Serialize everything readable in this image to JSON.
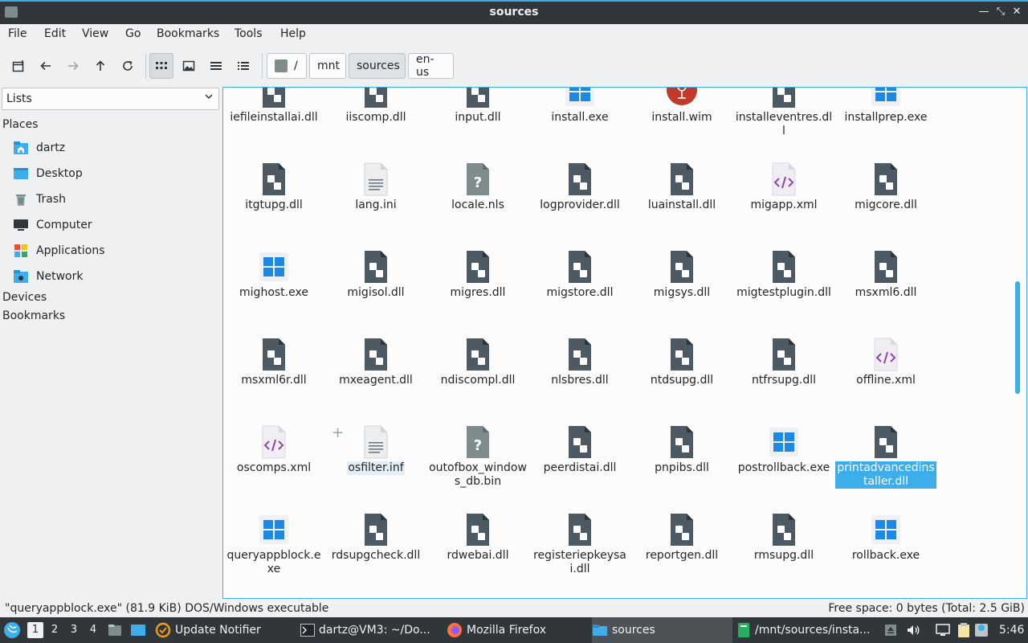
{
  "window": {
    "title": "sources"
  },
  "menu": [
    "File",
    "Edit",
    "View",
    "Go",
    "Bookmarks",
    "Tools",
    "Help"
  ],
  "breadcrumbs": [
    "/",
    "mnt",
    "sources",
    "en-us"
  ],
  "sidebar": {
    "mode": "Lists",
    "places_label": "Places",
    "places": [
      {
        "label": "dartz",
        "icon": "home-folder-icon"
      },
      {
        "label": "Desktop",
        "icon": "desktop-icon"
      },
      {
        "label": "Trash",
        "icon": "trash-icon"
      },
      {
        "label": "Computer",
        "icon": "computer-icon"
      },
      {
        "label": "Applications",
        "icon": "applications-icon"
      },
      {
        "label": "Network",
        "icon": "network-icon"
      }
    ],
    "devices_label": "Devices",
    "bookmarks_label": "Bookmarks"
  },
  "files": [
    {
      "name": "iefileinstallai.dll",
      "type": "dll"
    },
    {
      "name": "iiscomp.dll",
      "type": "dll"
    },
    {
      "name": "input.dll",
      "type": "dll"
    },
    {
      "name": "install.exe",
      "type": "exe"
    },
    {
      "name": "install.wim",
      "type": "wim"
    },
    {
      "name": "installeventres.dll",
      "type": "dll"
    },
    {
      "name": "installprep.exe",
      "type": "exe"
    },
    {
      "name": "itgtupg.dll",
      "type": "dll"
    },
    {
      "name": "lang.ini",
      "type": "text"
    },
    {
      "name": "locale.nls",
      "type": "unknown"
    },
    {
      "name": "logprovider.dll",
      "type": "dll"
    },
    {
      "name": "luainstall.dll",
      "type": "dll"
    },
    {
      "name": "migapp.xml",
      "type": "xml"
    },
    {
      "name": "migcore.dll",
      "type": "dll"
    },
    {
      "name": "mighost.exe",
      "type": "exe"
    },
    {
      "name": "migisol.dll",
      "type": "dll"
    },
    {
      "name": "migres.dll",
      "type": "dll"
    },
    {
      "name": "migstore.dll",
      "type": "dll"
    },
    {
      "name": "migsys.dll",
      "type": "dll"
    },
    {
      "name": "migtestplugin.dll",
      "type": "dll"
    },
    {
      "name": "msxml6.dll",
      "type": "dll"
    },
    {
      "name": "msxml6r.dll",
      "type": "dll"
    },
    {
      "name": "mxeagent.dll",
      "type": "dll"
    },
    {
      "name": "ndiscompl.dll",
      "type": "dll"
    },
    {
      "name": "nlsbres.dll",
      "type": "dll"
    },
    {
      "name": "ntdsupg.dll",
      "type": "dll"
    },
    {
      "name": "ntfrsupg.dll",
      "type": "dll"
    },
    {
      "name": "offline.xml",
      "type": "xml"
    },
    {
      "name": "oscomps.xml",
      "type": "xml"
    },
    {
      "name": "osfilter.inf",
      "type": "text",
      "state": "focus"
    },
    {
      "name": "outofbox_windows_db.bin",
      "type": "unknown"
    },
    {
      "name": "peerdistai.dll",
      "type": "dll"
    },
    {
      "name": "pnpibs.dll",
      "type": "dll"
    },
    {
      "name": "postrollback.exe",
      "type": "exe"
    },
    {
      "name": "printadvancedinstaller.dll",
      "type": "dll",
      "state": "selected"
    },
    {
      "name": "queryappblock.exe",
      "type": "exe"
    },
    {
      "name": "rdsupgcheck.dll",
      "type": "dll"
    },
    {
      "name": "rdwebai.dll",
      "type": "dll"
    },
    {
      "name": "registeriepkeysai.dll",
      "type": "dll"
    },
    {
      "name": "reportgen.dll",
      "type": "dll"
    },
    {
      "name": "rmsupg.dll",
      "type": "dll"
    },
    {
      "name": "rollback.exe",
      "type": "exe"
    }
  ],
  "status": {
    "left": "\"queryappblock.exe\" (81.9 KiB) DOS/Windows executable",
    "right": "Free space: 0 bytes (Total: 2.5 GiB)"
  },
  "taskbar": {
    "workspaces": [
      "1",
      "2",
      "3",
      "4"
    ],
    "tasks": [
      {
        "label": "Update Notifier",
        "icon": "update-icon"
      },
      {
        "label": "dartz@VM3: ~/Do...",
        "icon": "terminal-icon"
      },
      {
        "label": "Mozilla Firefox",
        "icon": "firefox-icon"
      },
      {
        "label": "sources",
        "icon": "folder-icon",
        "active": true
      },
      {
        "label": "/mnt/sources/insta...",
        "icon": "text-editor-icon"
      }
    ],
    "clock": "5:46"
  },
  "colors": {
    "accent": "#3daee9",
    "dark": "#31363b",
    "dll_icon": "#4d5a63",
    "win_blue": "#1e88e5",
    "xml_purple": "#8e44ad",
    "wim_red": "#c0392b"
  }
}
